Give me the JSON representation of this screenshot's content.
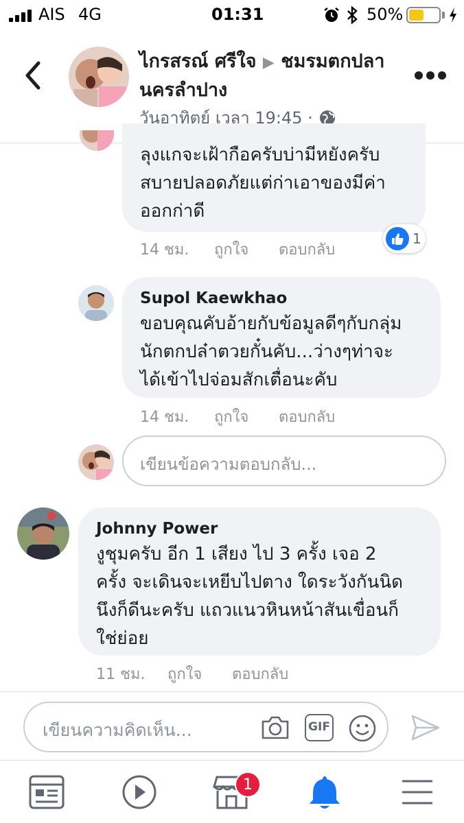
{
  "status_bar": {
    "carrier": "AIS",
    "network": "4G",
    "time": "01:31",
    "battery_percent": "50%",
    "battery_level": 0.5,
    "battery_color": "#f5c517"
  },
  "header": {
    "title": "ไกรสรณ์ ศรีใจ",
    "arrow": "▶",
    "group_line1": "ชมรมตกปลา",
    "group_line2": "นครลำปาง",
    "meta": "วันอาทิตย์ เวลา 19:45 ·"
  },
  "comments": [
    {
      "text": "ลุงแกจะเฝ้ากือครับบ่ามีหยังครับ\nสบายปลอดภัยแต่ก่าเอาของมีค่า\nออกก่าดี",
      "time": "14 ชม.",
      "like": "ถูกใจ",
      "reply": "ตอบกลับ",
      "reaction_count": "1"
    },
    {
      "author": "Supol Kaewkhao",
      "text": "ขอบคุณคับอ้ายกับข้อมูลดีๆกับกลุ่ม\nนักตกปล๋าตวยกั๋นคับ...ว่างๆท่าจะ\nได้เข้าไปจ่อมสักเตื่อนะคับ",
      "time": "14 ชม.",
      "like": "ถูกใจ",
      "reply": "ตอบกลับ"
    },
    {
      "author": "Johnny Power",
      "text": "งูชุมครับ อีก 1 เสียง ไป 3 ครั้ง เจอ 2\nครั้ง  จะเดินจะเหยีบไปตาง ใดระวังกันนิด\nนึงก็ดีนะครับ แถวแนวหินหน้าสันเขื่อนก็\nใช่ย่อย",
      "time": "11 ชม.",
      "like": "ถูกใจ",
      "reply": "ตอบกลับ"
    }
  ],
  "reply_box": {
    "placeholder": "เขียนข้อความตอบกลับ..."
  },
  "composer": {
    "placeholder": "เขียนความคิดเห็น...",
    "gif_label": "GIF"
  },
  "tabbar": {
    "marketplace_badge": "1"
  },
  "colors": {
    "accent": "#1877f2",
    "badge": "#e41e3f",
    "bubble": "#f0f2f5"
  }
}
